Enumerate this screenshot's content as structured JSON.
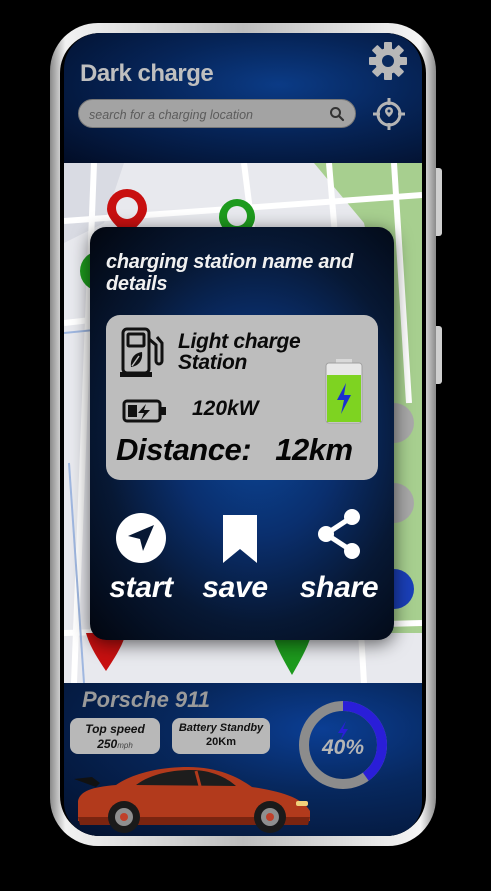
{
  "header": {
    "title": "Dark charge",
    "search_placeholder": "search for a charging location"
  },
  "station_card": {
    "title": "charging station name and details",
    "station_name": "Light charge Station",
    "power": "120kW",
    "distance_label": "Distance:",
    "distance_value": "12km",
    "actions": [
      {
        "label": "start",
        "icon": "navigation-arrow-icon"
      },
      {
        "label": "save",
        "icon": "bookmark-icon"
      },
      {
        "label": "share",
        "icon": "share-icon"
      }
    ]
  },
  "vehicle": {
    "name": "Porsche 911",
    "top_speed_label": "Top speed",
    "top_speed_value": "250",
    "top_speed_unit": "mph",
    "battery_standby_label": "Battery Standby",
    "battery_standby_value": "20Km",
    "battery_percent_label": "40%",
    "battery_level": 0.4
  },
  "icons": {
    "settings": "gear-icon",
    "search": "search-icon",
    "locate": "crosshair-location-icon",
    "pump": "fuel-pump-leaf-icon",
    "battery_small": "battery-charging-icon",
    "battery_big": "battery-full-bolt-icon"
  },
  "colors": {
    "accent_blue": "#0b3e94",
    "pin_red": "#c81010",
    "pin_green": "#1d9a1d",
    "battery_green": "#7ed321",
    "gauge_ring": "#8c8c8c",
    "gauge_fill": "#2a1ed8"
  }
}
